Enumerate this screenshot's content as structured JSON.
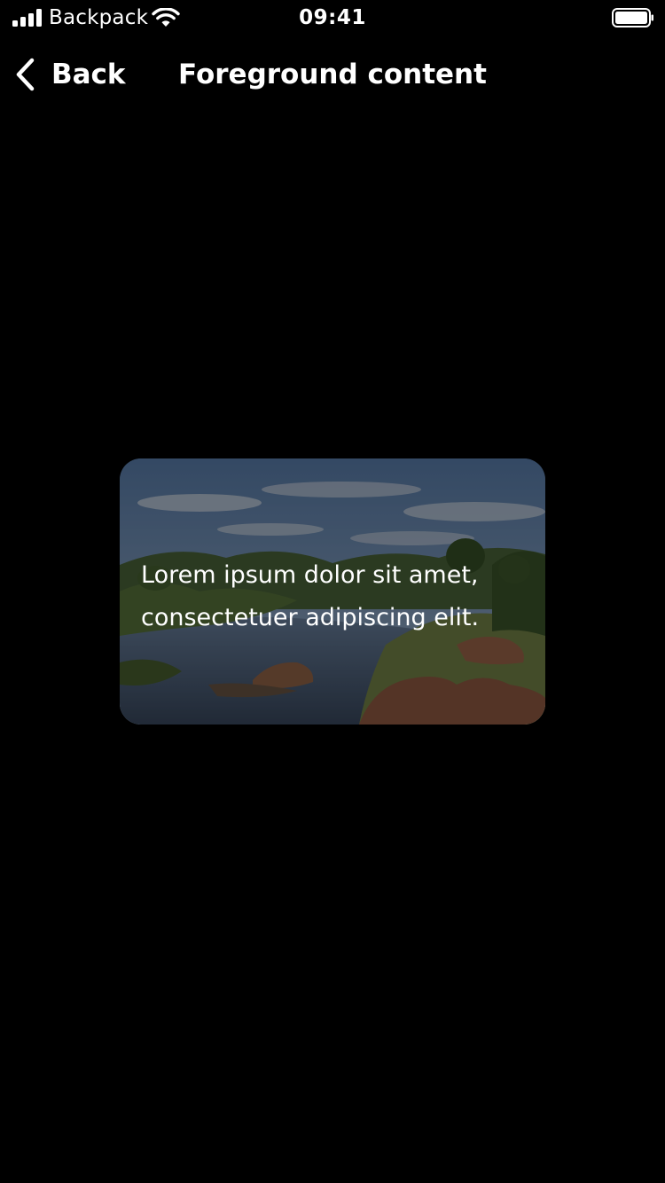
{
  "status_bar": {
    "carrier": "Backpack",
    "time": "09:41",
    "icons": {
      "signal": "signal-bars-icon",
      "wifi": "wifi-icon",
      "battery": "battery-full-icon"
    }
  },
  "nav": {
    "back_label": "Back",
    "back_icon": "chevron-left-icon",
    "title": "Foreground content"
  },
  "card": {
    "image": "landscape-river-photo",
    "text": "Lorem ipsum dolor sit amet, consectetuer adipiscing elit."
  },
  "colors": {
    "background": "#000000",
    "text": "#ffffff"
  }
}
